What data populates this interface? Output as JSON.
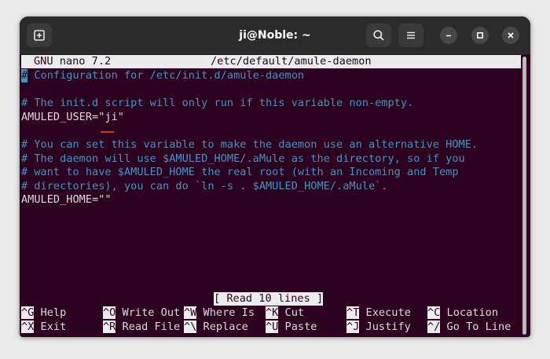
{
  "window": {
    "title": "ji@Noble: ~"
  },
  "nano": {
    "header_app": "GNU nano 7.2",
    "header_file": "/etc/default/amule-daemon",
    "cursor_char": "#",
    "lines": [
      {
        "row": 1,
        "type": "comment",
        "text": " Configuration for /etc/init.d/amule-daemon"
      },
      {
        "row": 3,
        "type": "comment",
        "text": "# The init.d script will only run if this variable non-empty."
      },
      {
        "row": 4,
        "type": "code",
        "text": "AMULED_USER=\"ji\""
      },
      {
        "row": 6,
        "type": "comment",
        "text": "# You can set this variable to make the daemon use an alternative HOME."
      },
      {
        "row": 7,
        "type": "comment",
        "text": "# The daemon will use $AMULED_HOME/.aMule as the directory, so if you"
      },
      {
        "row": 8,
        "type": "comment",
        "text": "# want to have $AMULED_HOME the real root (with an Incoming and Temp"
      },
      {
        "row": 9,
        "type": "comment",
        "text": "# directories), you can do `ln -s . $AMULED_HOME/.aMule`."
      },
      {
        "row": 10,
        "type": "code",
        "text": "AMULED_HOME=\"\""
      }
    ],
    "status_message": "[ Read 10 lines ]",
    "shortcuts_row1": [
      {
        "key": "^G",
        "label": "Help"
      },
      {
        "key": "^O",
        "label": "Write Out"
      },
      {
        "key": "^W",
        "label": "Where Is"
      },
      {
        "key": "^K",
        "label": "Cut"
      },
      {
        "key": "^T",
        "label": "Execute"
      },
      {
        "key": "^C",
        "label": "Location"
      }
    ],
    "shortcuts_row2": [
      {
        "key": "^X",
        "label": "Exit"
      },
      {
        "key": "^R",
        "label": "Read File"
      },
      {
        "key": "^\\",
        "label": "Replace"
      },
      {
        "key": "^U",
        "label": "Paste"
      },
      {
        "key": "^J",
        "label": "Justify"
      },
      {
        "key": "^/",
        "label": "Go To Line"
      }
    ]
  },
  "colors": {
    "terminal_bg": "#2c001e",
    "comment": "#3d96c8",
    "text": "#dcdcdc",
    "spell_underline": "#d92f2f"
  },
  "icons": {
    "new_tab": "new-tab-icon",
    "search": "search-icon",
    "menu": "hamburger-menu-icon",
    "minimize": "minimize-icon",
    "maximize": "maximize-icon",
    "close": "close-icon"
  }
}
